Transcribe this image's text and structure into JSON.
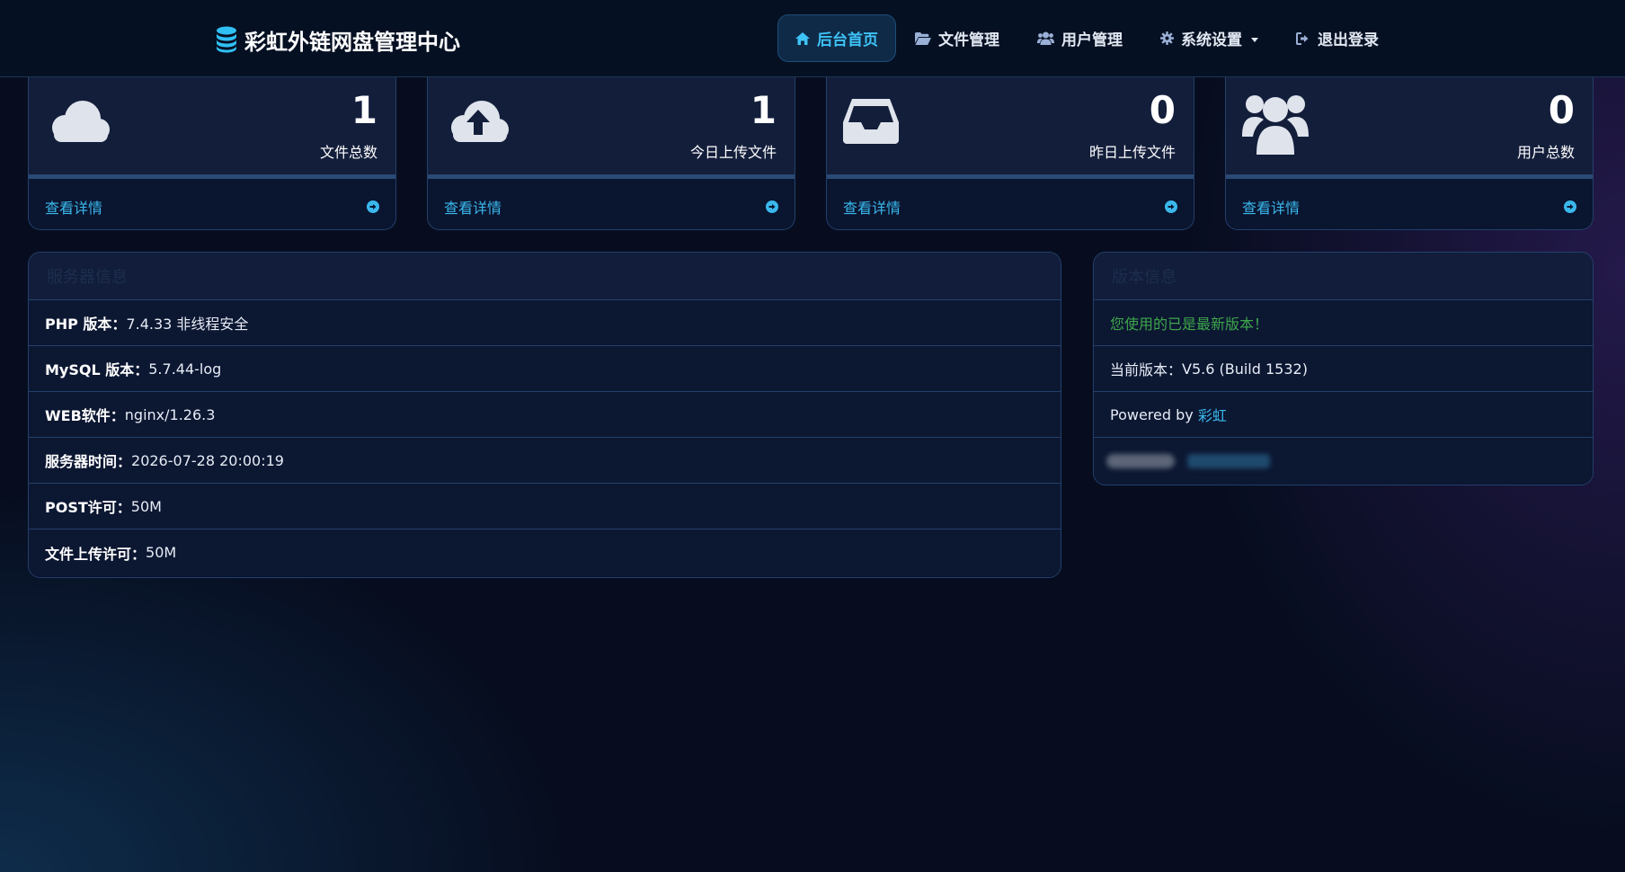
{
  "navbar": {
    "brand_title": "彩虹外链网盘管理中心",
    "brand_icon": "database-icon",
    "items": [
      {
        "label": "后台首页",
        "icon": "home-icon",
        "active": true
      },
      {
        "label": "文件管理",
        "icon": "folder-open-icon",
        "active": false
      },
      {
        "label": "用户管理",
        "icon": "users-icon",
        "active": false
      },
      {
        "label": "系统设置",
        "icon": "gear-icon",
        "active": false,
        "dropdown": true
      },
      {
        "label": "退出登录",
        "icon": "sign-out-icon",
        "active": false
      }
    ]
  },
  "stats": [
    {
      "value": "1",
      "label": "文件总数",
      "icon": "cloud-icon",
      "link": "查看详情"
    },
    {
      "value": "1",
      "label": "今日上传文件",
      "icon": "cloud-upload-icon",
      "link": "查看详情"
    },
    {
      "value": "0",
      "label": "昨日上传文件",
      "icon": "inbox-icon",
      "link": "查看详情"
    },
    {
      "value": "0",
      "label": "用户总数",
      "icon": "users-icon",
      "link": "查看详情"
    }
  ],
  "server_info": {
    "title": "服务器信息",
    "rows": [
      {
        "label": "PHP 版本：",
        "value": "7.4.33 非线程安全"
      },
      {
        "label": "MySQL 版本：",
        "value": "5.7.44-log"
      },
      {
        "label": "WEB软件：",
        "value": "nginx/1.26.3"
      },
      {
        "label": "服务器时间：",
        "value": "2026-07-28 20:00:19"
      },
      {
        "label": "POST许可：",
        "value": "50M"
      },
      {
        "label": "文件上传许可：",
        "value": "50M"
      }
    ]
  },
  "version_info": {
    "title": "版本信息",
    "status": "您使用的已是最新版本！",
    "current_label": "当前版本：",
    "current_value": "V5.6 (Build 1532)",
    "powered_by": "Powered by ",
    "powered_link": "彩虹"
  },
  "colors": {
    "background": "#070d1f",
    "accent": "#3ab8ec",
    "success": "#3da64a",
    "panel_border": "#23406a"
  }
}
